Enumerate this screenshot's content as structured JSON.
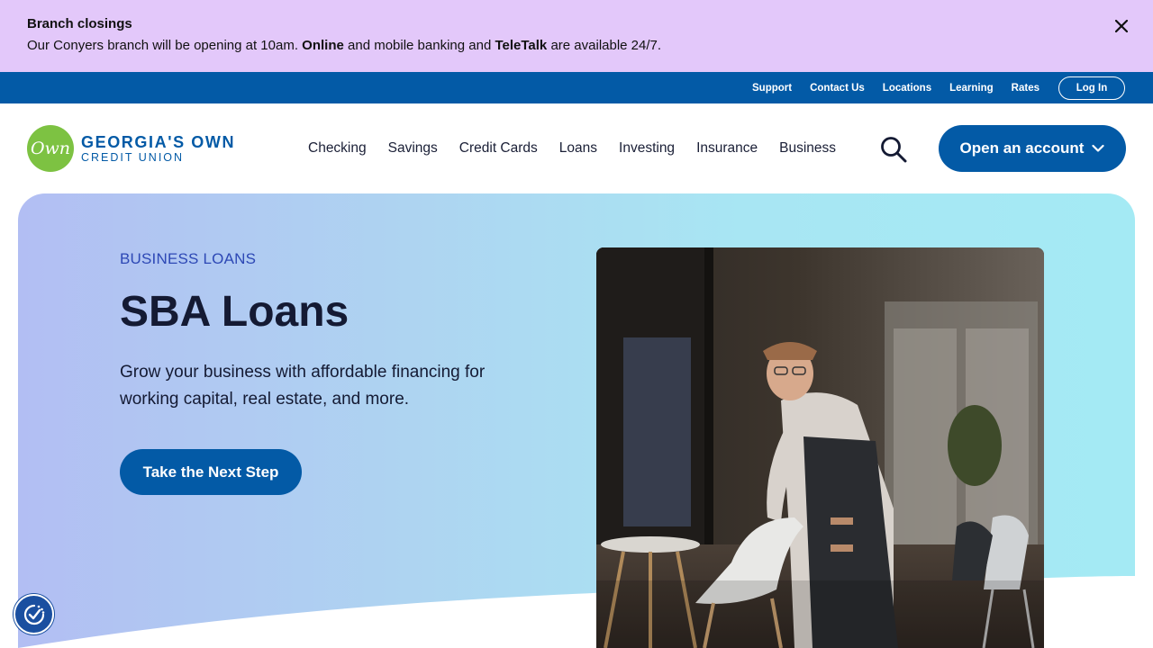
{
  "alert": {
    "title": "Branch closings",
    "msg_part1": "Our Conyers branch will be opening at 10am. ",
    "msg_bold1": "Online",
    "msg_part2": " and mobile banking and ",
    "msg_bold2": "TeleTalk",
    "msg_part3": " are available 24/7."
  },
  "utility": {
    "links": [
      "Support",
      "Contact Us",
      "Locations",
      "Learning",
      "Rates"
    ],
    "login": "Log In"
  },
  "logo": {
    "mark": "Own",
    "line1": "GEORGIA'S OWN",
    "line2": "CREDIT UNION"
  },
  "nav": {
    "items": [
      "Checking",
      "Savings",
      "Credit Cards",
      "Loans",
      "Investing",
      "Insurance",
      "Business"
    ],
    "cta": "Open an account"
  },
  "hero": {
    "eyebrow": "BUSINESS LOANS",
    "title": "SBA Loans",
    "description": "Grow your business with affordable financing for working capital, real estate, and more.",
    "cta": "Take the Next Step"
  },
  "colors": {
    "alert_bg": "#e3c8fa",
    "brand_blue": "#035aa6",
    "logo_green": "#7dc242",
    "eyebrow": "#2d48b5"
  },
  "icons": {
    "close": "close-icon",
    "search": "search-icon",
    "chevron": "chevron-down-icon",
    "accessibility": "accessibility-icon"
  }
}
